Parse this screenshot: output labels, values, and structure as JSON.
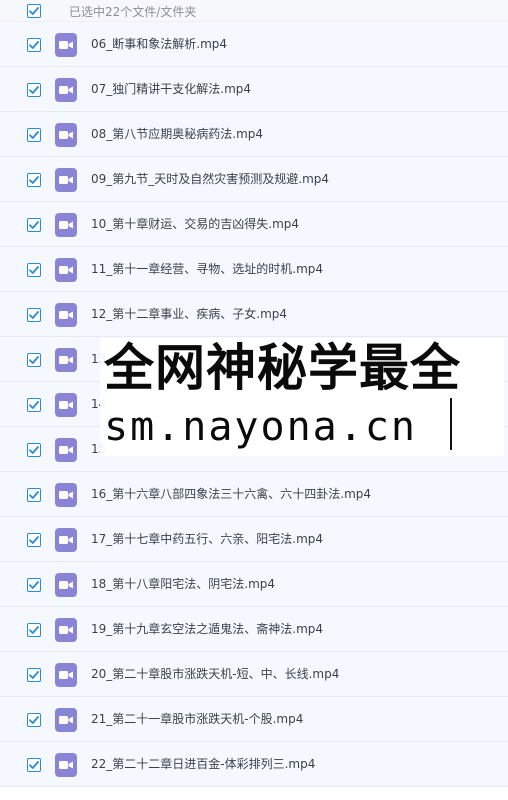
{
  "header": {
    "selected_text": "已选中22个文件/文件夹"
  },
  "files": [
    {
      "name": "06_断事和象法解析.mp4",
      "checked": true
    },
    {
      "name": "07_独门精讲干支化解法.mp4",
      "checked": true
    },
    {
      "name": "08_第八节应期奥秘病药法.mp4",
      "checked": true
    },
    {
      "name": "09_第九节_天时及自然灾害预测及规避.mp4",
      "checked": true
    },
    {
      "name": "10_第十章财运、交易的吉凶得失.mp4",
      "checked": true
    },
    {
      "name": "11_第十一章经营、寻物、选址的时机.mp4",
      "checked": true
    },
    {
      "name": "12_第十二章事业、疾病、子女.mp4",
      "checked": true
    },
    {
      "name": "13",
      "checked": true
    },
    {
      "name": "14",
      "checked": true
    },
    {
      "name": "15",
      "checked": true
    },
    {
      "name": "16_第十六章八部四象法三十六禽、六十四卦法.mp4",
      "checked": true
    },
    {
      "name": "17_第十七章中药五行、六亲、阳宅法.mp4",
      "checked": true
    },
    {
      "name": "18_第十八章阳宅法、阴宅法.mp4",
      "checked": true
    },
    {
      "name": "19_第十九章玄空法之遁鬼法、斋神法.mp4",
      "checked": true
    },
    {
      "name": "20_第二十章股市涨跌天机-短、中、长线.mp4",
      "checked": true
    },
    {
      "name": "21_第二十一章股市涨跌天机-个股.mp4",
      "checked": true
    },
    {
      "name": "22_第二十二章日进百金-体彩排列三.mp4",
      "checked": true
    }
  ],
  "watermark": {
    "line1": "全网神秘学最全",
    "line2": "sm.nayona.cn"
  },
  "colors": {
    "checkbox_accent": "#2a8bd8",
    "video_icon": "#8a84d6",
    "row_bg": "#f5f9ff"
  },
  "icons": {
    "checkbox": "check-icon",
    "file": "video-file-icon"
  }
}
